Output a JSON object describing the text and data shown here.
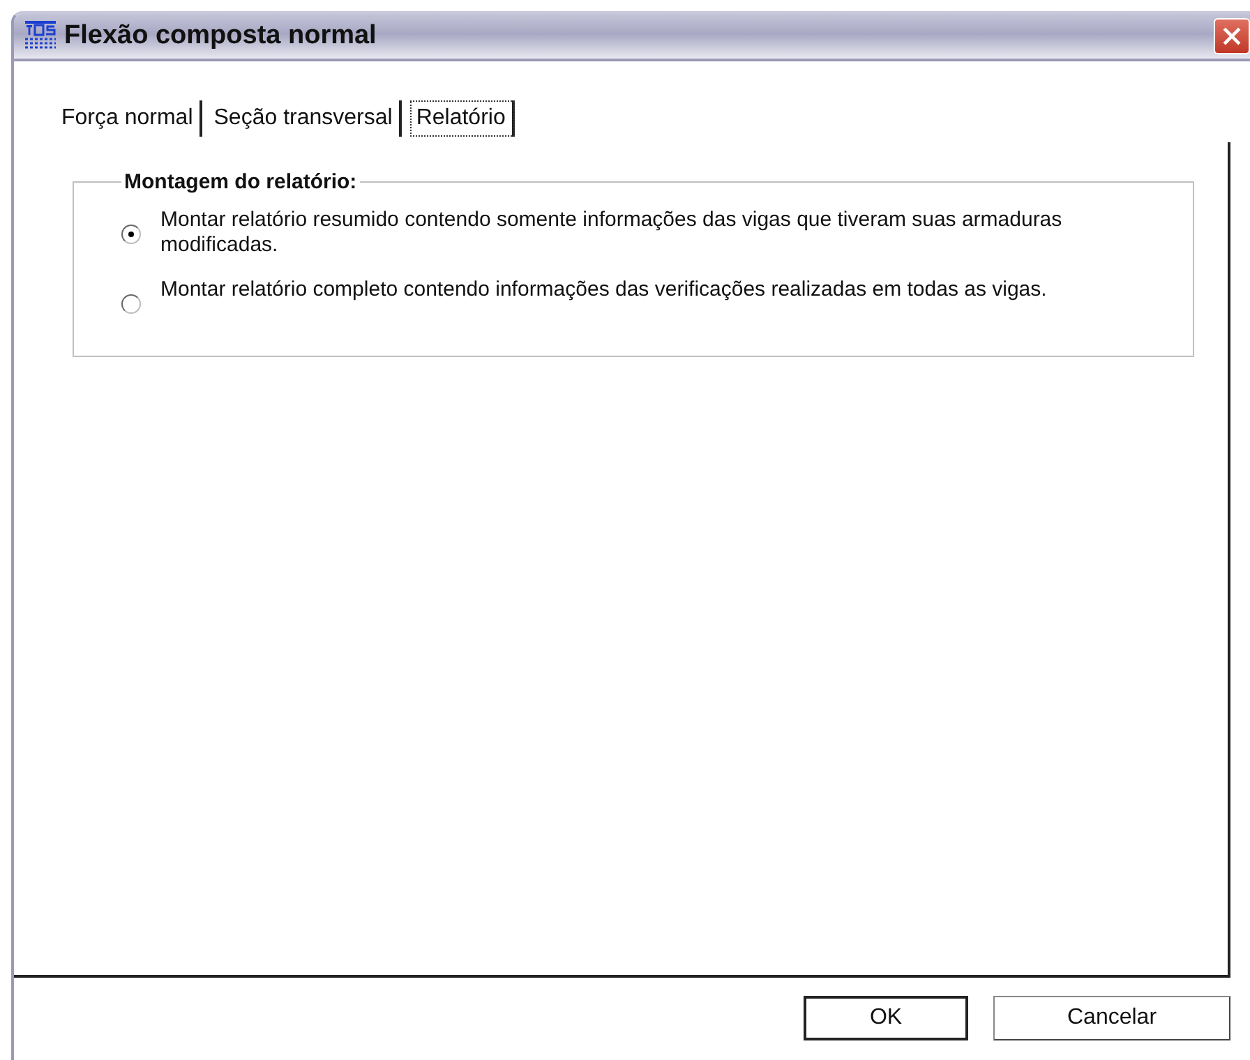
{
  "window": {
    "title": "Flexão composta normal"
  },
  "tabs": [
    {
      "label": "Força normal",
      "selected": false
    },
    {
      "label": "Seção transversal",
      "selected": false
    },
    {
      "label": "Relatório",
      "selected": true
    }
  ],
  "group": {
    "title": "Montagem do relatório:",
    "options": [
      {
        "label": "Montar relatório resumido contendo somente informações das vigas que tiveram suas armaduras modificadas.",
        "selected": true
      },
      {
        "label": "Montar relatório completo contendo informações das verificações realizadas em todas as vigas.",
        "selected": false
      }
    ]
  },
  "buttons": [
    {
      "label": "OK",
      "default": true
    },
    {
      "label": "Cancelar",
      "default": false
    }
  ]
}
